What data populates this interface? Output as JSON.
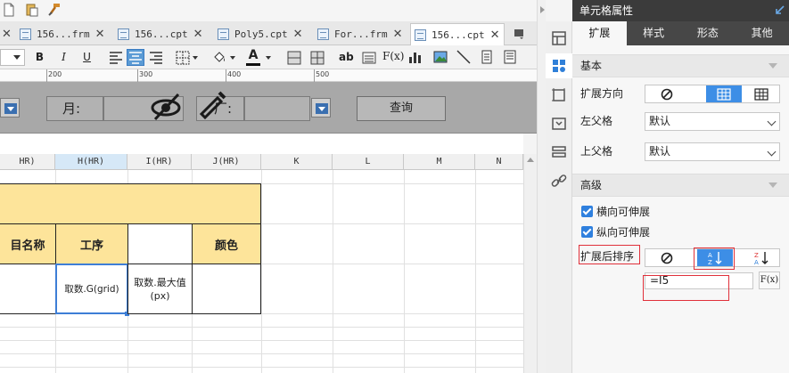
{
  "tabs": [
    {
      "label": "156...frm",
      "active": false
    },
    {
      "label": "156...cpt",
      "active": false
    },
    {
      "label": "Poly5.cpt",
      "active": false
    },
    {
      "label": "For...frm",
      "active": false
    },
    {
      "label": "156...cpt",
      "active": true
    }
  ],
  "format_toolbar": {
    "bold": "B",
    "italic": "I",
    "underline": "U",
    "text_color": "A"
  },
  "ruler": {
    "marks": [
      "200",
      "300",
      "400",
      "500"
    ]
  },
  "params": {
    "month_label": "月:",
    "factory_label": "厂:",
    "query_button": "查询"
  },
  "columns": [
    {
      "label": "HR)",
      "selected": false
    },
    {
      "label": "H(HR)",
      "selected": true
    },
    {
      "label": "I(HR)",
      "selected": false
    },
    {
      "label": "J(HR)",
      "selected": false
    },
    {
      "label": "K",
      "selected": false
    },
    {
      "label": "L",
      "selected": false
    },
    {
      "label": "M",
      "selected": false
    },
    {
      "label": "N",
      "selected": false
    }
  ],
  "table": {
    "header_cells": [
      "目名称",
      "工序",
      "",
      "颜色"
    ],
    "data_cells": [
      "",
      "取数.G(grid)",
      "取数.最大值(px)",
      ""
    ]
  },
  "right_panel": {
    "title": "单元格属性",
    "tabs": [
      "扩展",
      "样式",
      "形态",
      "其他"
    ],
    "active_tab": "扩展",
    "basic_section": "基本",
    "expand_direction_label": "扩展方向",
    "left_parent_label": "左父格",
    "left_parent_value": "默认",
    "top_parent_label": "上父格",
    "top_parent_value": "默认",
    "advanced_section": "高级",
    "horizontal_extend_label": "横向可伸展",
    "vertical_extend_label": "纵向可伸展",
    "sort_label": "扩展后排序",
    "sort_formula": "=I5",
    "formula_button": "F(x)"
  },
  "colors": {
    "accent": "#3d8ee6",
    "header_fill": "#fde49a",
    "highlight_red": "#e0303a",
    "panel_dark": "#3b3b3b"
  }
}
